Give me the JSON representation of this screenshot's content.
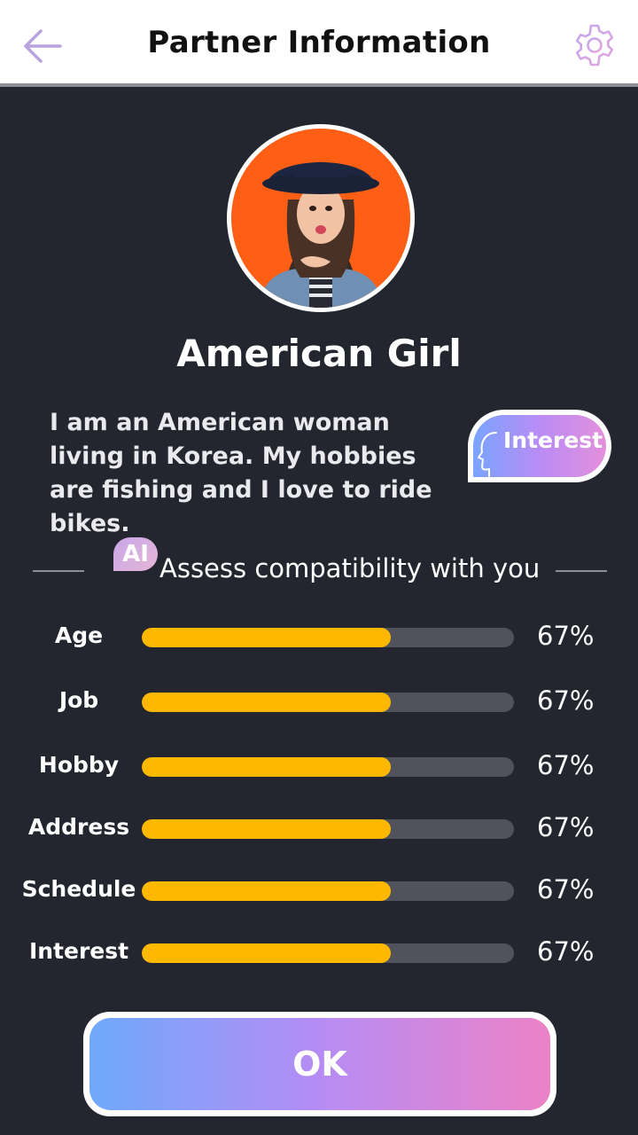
{
  "header": {
    "title": "Partner Information"
  },
  "profile": {
    "name": "American Girl",
    "bio": "I am an American woman living in Korea. My hobbies are fishing and I love to ride bikes.",
    "interest_button": "Interest"
  },
  "compatibility": {
    "ai_badge": "AI",
    "title": "Assess compatibility with you",
    "items": [
      {
        "label": "Age",
        "value": 0.67,
        "percent_text": "67%"
      },
      {
        "label": "Job",
        "value": 0.67,
        "percent_text": "67%"
      },
      {
        "label": "Hobby",
        "value": 0.67,
        "percent_text": "67%"
      },
      {
        "label": "Address",
        "value": 0.67,
        "percent_text": "67%"
      },
      {
        "label": "Schedule",
        "value": 0.67,
        "percent_text": "67%"
      },
      {
        "label": "Interest",
        "value": 0.67,
        "percent_text": "67%"
      }
    ]
  },
  "actions": {
    "ok_label": "OK"
  },
  "colors": {
    "background": "#23252f",
    "bar_fill": "#ffb800",
    "bar_track": "#50525c",
    "accent_purple": "#b98cf5"
  },
  "icons": {
    "back": "arrow-left-icon",
    "settings": "gear-icon",
    "avatar": "profile-photo"
  }
}
